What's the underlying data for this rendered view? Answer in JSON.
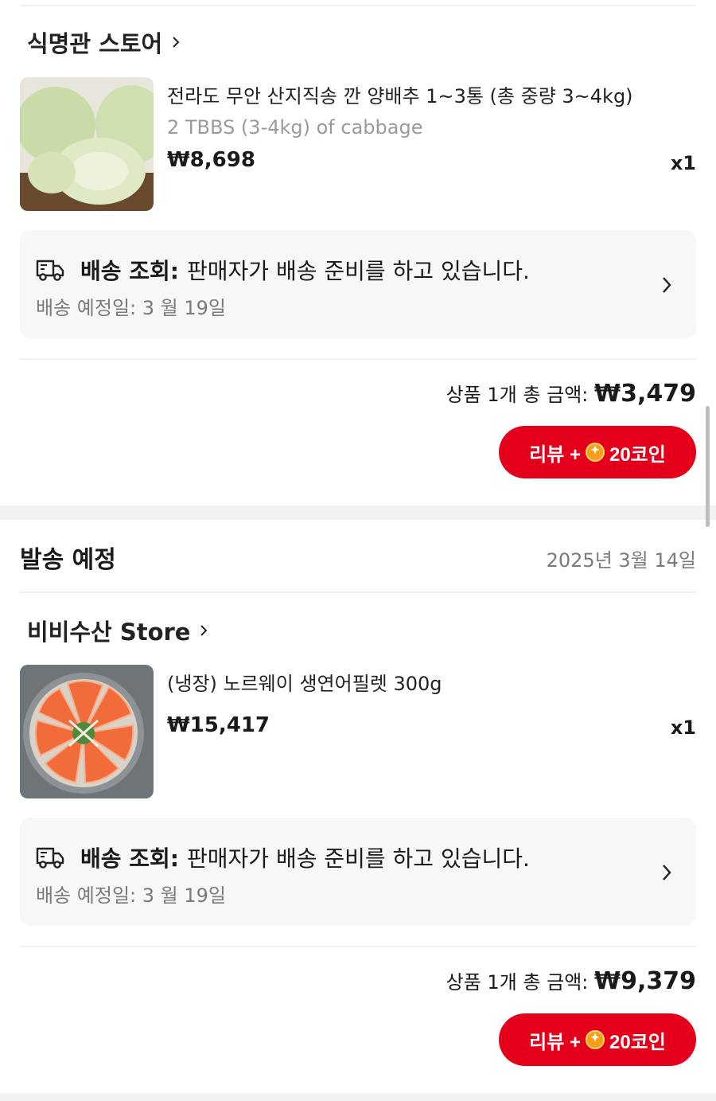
{
  "orders": [
    {
      "store_name": "식명관 스토어",
      "product": {
        "title": "전라도 무안 산지직송 깐 양배추 1~3통 (총 중량 3~4kg)",
        "subtitle": "2 TBBS (3-4kg) of cabbage",
        "price": "₩8,698",
        "qty": "x1"
      },
      "shipping": {
        "label": "배송 조회:",
        "status": "판매자가 배송 준비를 하고 있습니다.",
        "eta": "배송 예정일: 3 월 19일"
      },
      "total_label": "상품 1개 총 금액:",
      "total_amount": "₩3,479",
      "review_prefix": "리뷰 +",
      "review_coins": "20코인"
    },
    {
      "section_title": "발송 예정",
      "section_date": "2025년 3월 14일",
      "store_name": "비비수산 Store",
      "product": {
        "title": "(냉장) 노르웨이 생연어필렛 300g",
        "price": "₩15,417",
        "qty": "x1"
      },
      "shipping": {
        "label": "배송 조회:",
        "status": "판매자가 배송 준비를 하고 있습니다.",
        "eta": "배송 예정일: 3 월 19일"
      },
      "total_label": "상품 1개 총 금액:",
      "total_amount": "₩9,379",
      "review_prefix": "리뷰 +",
      "review_coins": "20코인"
    }
  ],
  "colors": {
    "accent": "#e4001b",
    "coin": "#f6a01a",
    "box": "#f7f7f7"
  }
}
